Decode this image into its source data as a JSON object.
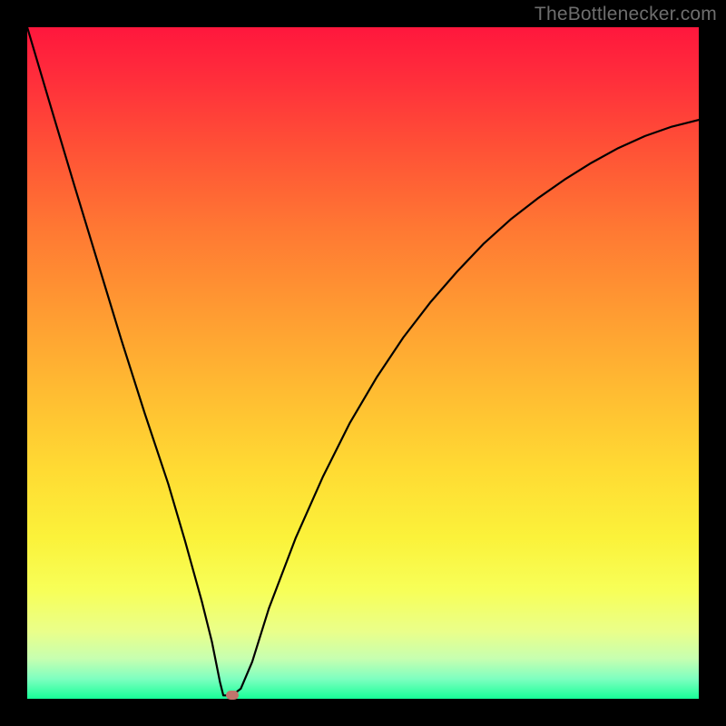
{
  "attribution": "TheBottlenecker.com",
  "chart_data": {
    "type": "line",
    "title": "",
    "xlabel": "",
    "ylabel": "",
    "xlim": [
      0,
      1
    ],
    "ylim": [
      0,
      1
    ],
    "marker": {
      "x": 0.305,
      "y": 0.005
    },
    "series": [
      {
        "name": "curve",
        "points": [
          {
            "x": 0.0,
            "y": 1.0
          },
          {
            "x": 0.035,
            "y": 0.882
          },
          {
            "x": 0.07,
            "y": 0.765
          },
          {
            "x": 0.105,
            "y": 0.65
          },
          {
            "x": 0.14,
            "y": 0.535
          },
          {
            "x": 0.175,
            "y": 0.425
          },
          {
            "x": 0.21,
            "y": 0.32
          },
          {
            "x": 0.235,
            "y": 0.235
          },
          {
            "x": 0.26,
            "y": 0.145
          },
          {
            "x": 0.275,
            "y": 0.085
          },
          {
            "x": 0.287,
            "y": 0.025
          },
          {
            "x": 0.292,
            "y": 0.005
          },
          {
            "x": 0.305,
            "y": 0.005
          },
          {
            "x": 0.318,
            "y": 0.015
          },
          {
            "x": 0.335,
            "y": 0.055
          },
          {
            "x": 0.36,
            "y": 0.135
          },
          {
            "x": 0.4,
            "y": 0.24
          },
          {
            "x": 0.44,
            "y": 0.33
          },
          {
            "x": 0.48,
            "y": 0.41
          },
          {
            "x": 0.52,
            "y": 0.478
          },
          {
            "x": 0.56,
            "y": 0.538
          },
          {
            "x": 0.6,
            "y": 0.59
          },
          {
            "x": 0.64,
            "y": 0.636
          },
          {
            "x": 0.68,
            "y": 0.678
          },
          {
            "x": 0.72,
            "y": 0.714
          },
          {
            "x": 0.76,
            "y": 0.745
          },
          {
            "x": 0.8,
            "y": 0.773
          },
          {
            "x": 0.84,
            "y": 0.798
          },
          {
            "x": 0.88,
            "y": 0.82
          },
          {
            "x": 0.92,
            "y": 0.838
          },
          {
            "x": 0.96,
            "y": 0.852
          },
          {
            "x": 1.0,
            "y": 0.862
          }
        ]
      }
    ],
    "gradient": [
      "#ff173d",
      "#ffdb33",
      "#17ff98"
    ]
  }
}
